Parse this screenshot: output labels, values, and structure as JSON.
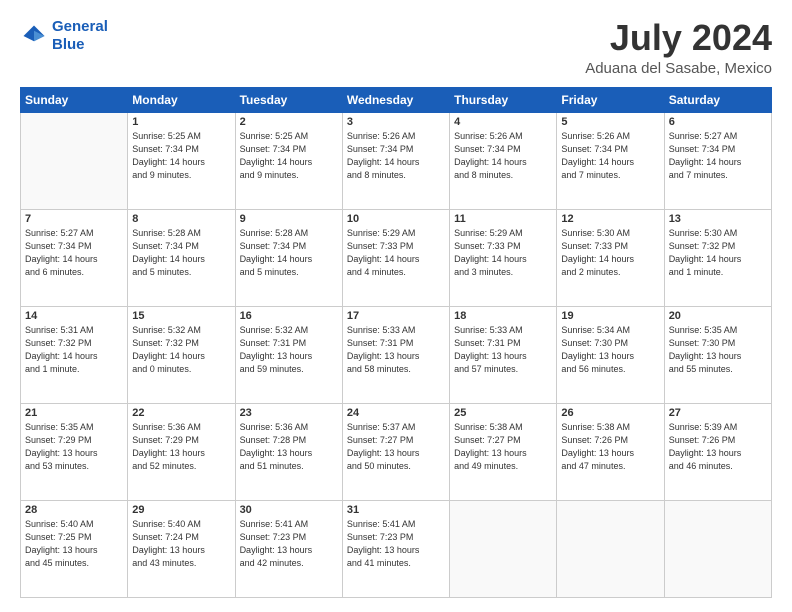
{
  "header": {
    "logo_line1": "General",
    "logo_line2": "Blue",
    "month": "July 2024",
    "location": "Aduana del Sasabe, Mexico"
  },
  "days_of_week": [
    "Sunday",
    "Monday",
    "Tuesday",
    "Wednesday",
    "Thursday",
    "Friday",
    "Saturday"
  ],
  "weeks": [
    [
      {
        "day": "",
        "info": ""
      },
      {
        "day": "1",
        "info": "Sunrise: 5:25 AM\nSunset: 7:34 PM\nDaylight: 14 hours\nand 9 minutes."
      },
      {
        "day": "2",
        "info": "Sunrise: 5:25 AM\nSunset: 7:34 PM\nDaylight: 14 hours\nand 9 minutes."
      },
      {
        "day": "3",
        "info": "Sunrise: 5:26 AM\nSunset: 7:34 PM\nDaylight: 14 hours\nand 8 minutes."
      },
      {
        "day": "4",
        "info": "Sunrise: 5:26 AM\nSunset: 7:34 PM\nDaylight: 14 hours\nand 8 minutes."
      },
      {
        "day": "5",
        "info": "Sunrise: 5:26 AM\nSunset: 7:34 PM\nDaylight: 14 hours\nand 7 minutes."
      },
      {
        "day": "6",
        "info": "Sunrise: 5:27 AM\nSunset: 7:34 PM\nDaylight: 14 hours\nand 7 minutes."
      }
    ],
    [
      {
        "day": "7",
        "info": "Sunrise: 5:27 AM\nSunset: 7:34 PM\nDaylight: 14 hours\nand 6 minutes."
      },
      {
        "day": "8",
        "info": "Sunrise: 5:28 AM\nSunset: 7:34 PM\nDaylight: 14 hours\nand 5 minutes."
      },
      {
        "day": "9",
        "info": "Sunrise: 5:28 AM\nSunset: 7:34 PM\nDaylight: 14 hours\nand 5 minutes."
      },
      {
        "day": "10",
        "info": "Sunrise: 5:29 AM\nSunset: 7:33 PM\nDaylight: 14 hours\nand 4 minutes."
      },
      {
        "day": "11",
        "info": "Sunrise: 5:29 AM\nSunset: 7:33 PM\nDaylight: 14 hours\nand 3 minutes."
      },
      {
        "day": "12",
        "info": "Sunrise: 5:30 AM\nSunset: 7:33 PM\nDaylight: 14 hours\nand 2 minutes."
      },
      {
        "day": "13",
        "info": "Sunrise: 5:30 AM\nSunset: 7:32 PM\nDaylight: 14 hours\nand 1 minute."
      }
    ],
    [
      {
        "day": "14",
        "info": "Sunrise: 5:31 AM\nSunset: 7:32 PM\nDaylight: 14 hours\nand 1 minute."
      },
      {
        "day": "15",
        "info": "Sunrise: 5:32 AM\nSunset: 7:32 PM\nDaylight: 14 hours\nand 0 minutes."
      },
      {
        "day": "16",
        "info": "Sunrise: 5:32 AM\nSunset: 7:31 PM\nDaylight: 13 hours\nand 59 minutes."
      },
      {
        "day": "17",
        "info": "Sunrise: 5:33 AM\nSunset: 7:31 PM\nDaylight: 13 hours\nand 58 minutes."
      },
      {
        "day": "18",
        "info": "Sunrise: 5:33 AM\nSunset: 7:31 PM\nDaylight: 13 hours\nand 57 minutes."
      },
      {
        "day": "19",
        "info": "Sunrise: 5:34 AM\nSunset: 7:30 PM\nDaylight: 13 hours\nand 56 minutes."
      },
      {
        "day": "20",
        "info": "Sunrise: 5:35 AM\nSunset: 7:30 PM\nDaylight: 13 hours\nand 55 minutes."
      }
    ],
    [
      {
        "day": "21",
        "info": "Sunrise: 5:35 AM\nSunset: 7:29 PM\nDaylight: 13 hours\nand 53 minutes."
      },
      {
        "day": "22",
        "info": "Sunrise: 5:36 AM\nSunset: 7:29 PM\nDaylight: 13 hours\nand 52 minutes."
      },
      {
        "day": "23",
        "info": "Sunrise: 5:36 AM\nSunset: 7:28 PM\nDaylight: 13 hours\nand 51 minutes."
      },
      {
        "day": "24",
        "info": "Sunrise: 5:37 AM\nSunset: 7:27 PM\nDaylight: 13 hours\nand 50 minutes."
      },
      {
        "day": "25",
        "info": "Sunrise: 5:38 AM\nSunset: 7:27 PM\nDaylight: 13 hours\nand 49 minutes."
      },
      {
        "day": "26",
        "info": "Sunrise: 5:38 AM\nSunset: 7:26 PM\nDaylight: 13 hours\nand 47 minutes."
      },
      {
        "day": "27",
        "info": "Sunrise: 5:39 AM\nSunset: 7:26 PM\nDaylight: 13 hours\nand 46 minutes."
      }
    ],
    [
      {
        "day": "28",
        "info": "Sunrise: 5:40 AM\nSunset: 7:25 PM\nDaylight: 13 hours\nand 45 minutes."
      },
      {
        "day": "29",
        "info": "Sunrise: 5:40 AM\nSunset: 7:24 PM\nDaylight: 13 hours\nand 43 minutes."
      },
      {
        "day": "30",
        "info": "Sunrise: 5:41 AM\nSunset: 7:23 PM\nDaylight: 13 hours\nand 42 minutes."
      },
      {
        "day": "31",
        "info": "Sunrise: 5:41 AM\nSunset: 7:23 PM\nDaylight: 13 hours\nand 41 minutes."
      },
      {
        "day": "",
        "info": ""
      },
      {
        "day": "",
        "info": ""
      },
      {
        "day": "",
        "info": ""
      }
    ]
  ]
}
